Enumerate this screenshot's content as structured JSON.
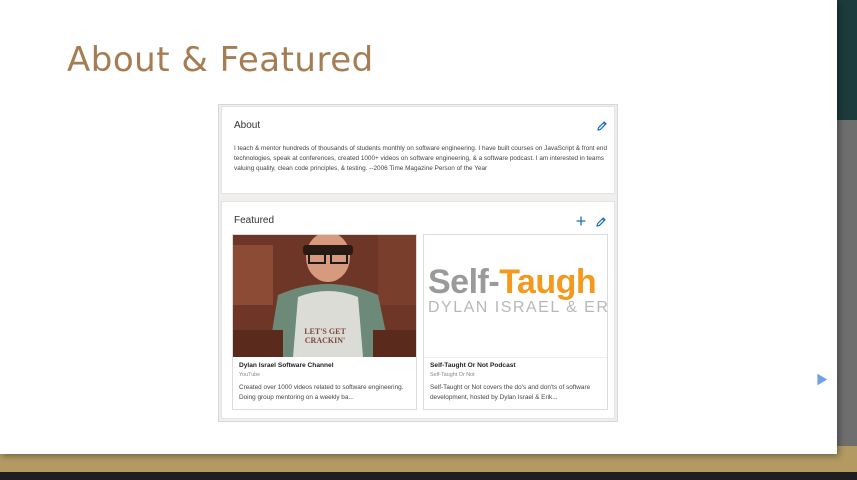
{
  "slide": {
    "title": "About & Featured"
  },
  "about": {
    "heading": "About",
    "text": "I teach & mentor hundreds of thousands of students monthly on software engineering. I have built courses on JavaScript & front end technologies, speak at conferences, created 1000+ videos on software engineering, & a software podcast. I am interested in teams valuing quality, clean code principles, & testing. --2006 Time Magazine Person of the Year"
  },
  "featured": {
    "heading": "Featured",
    "items": [
      {
        "title": "Dylan Israel Software Channel",
        "source": "YouTube",
        "description": "Created over 1000 videos related to software engineering. Doing group mentoring on a weekly ba...",
        "thumbnail": {
          "shirt_text_1": "LET'S GET",
          "shirt_text_2": "CRACKIN'"
        }
      },
      {
        "title": "Self-Taught Or Not Podcast",
        "source": "Self-Taught Or Not",
        "description": "Self-Taught or Not covers the do's and don'ts of software development, hosted by Dylan Israel & Erik...",
        "thumbnail": {
          "logo_part_1": "Self-",
          "logo_part_2": "Taugh",
          "logo_sub": "DYLAN ISRAEL & ER"
        }
      }
    ]
  },
  "icons": {
    "edit": "pencil-icon",
    "add": "plus-icon",
    "cursor": "pointer-cursor-icon"
  },
  "colors": {
    "title": "#a67c52",
    "link_blue": "#1a70b8",
    "logo_orange": "#f39a1e",
    "logo_grey": "#9a9a9a",
    "gold_band": "#b39a62",
    "teal_corner": "#1d3a3c"
  }
}
